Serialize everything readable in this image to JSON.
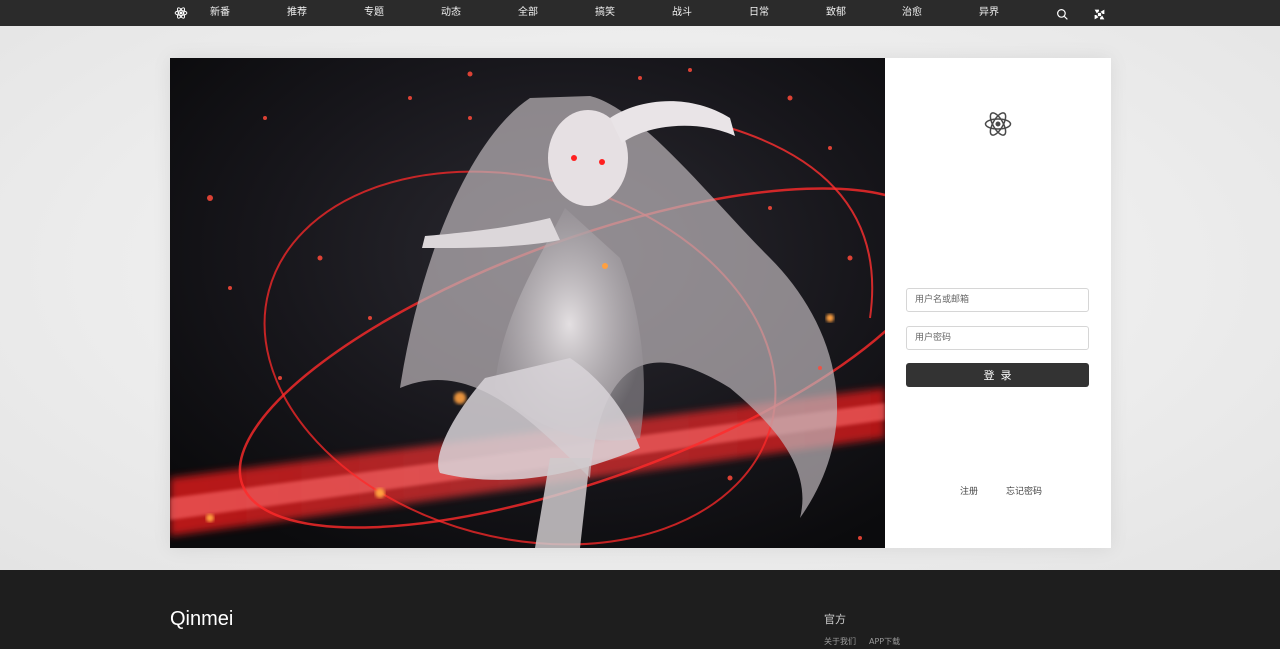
{
  "nav": {
    "items": [
      {
        "label": "新番"
      },
      {
        "label": "推荐"
      },
      {
        "label": "专题"
      },
      {
        "label": "动态"
      },
      {
        "label": "全部"
      },
      {
        "label": "搞笑"
      },
      {
        "label": "战斗"
      },
      {
        "label": "日常"
      },
      {
        "label": "致郁"
      },
      {
        "label": "治愈"
      },
      {
        "label": "异界"
      }
    ],
    "icons": [
      "atom-logo-icon",
      "search-icon",
      "shuffle-icon"
    ]
  },
  "login": {
    "username_placeholder": "用户名或邮箱",
    "password_placeholder": "用户密码",
    "submit_label": "登录",
    "register_label": "注册",
    "forgot_label": "忘记密码"
  },
  "footer": {
    "brand": "Qinmei",
    "heading": "官方",
    "links": [
      {
        "label": "关于我们"
      },
      {
        "label": "APP下载"
      }
    ]
  },
  "colors": {
    "nav_bg": "#2b2b2b",
    "button_bg": "#333333",
    "footer_bg": "#1e1e1e",
    "hero_accent": "#ff2a2a"
  }
}
